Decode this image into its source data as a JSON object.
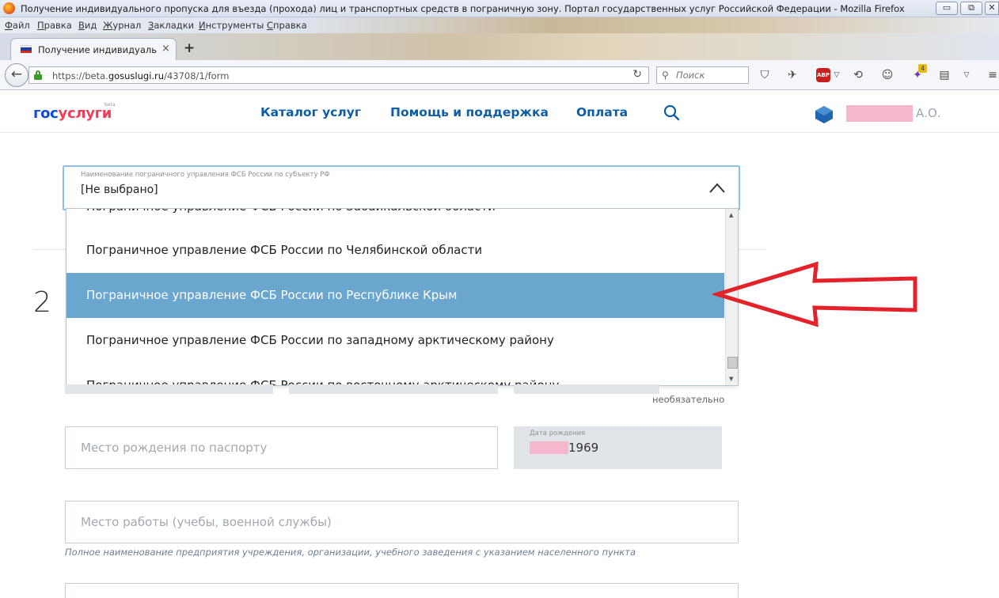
{
  "window": {
    "title": "Получение индивидуального пропуска для въезда (прохода) лиц и транспортных средств в пограничную зону. Портал государственных услуг Российской Федерации - Mozilla Firefox",
    "min_glyph": "▭",
    "max_glyph": "⧉",
    "close_glyph": "✕"
  },
  "menubar": {
    "items": [
      {
        "ul": "Ф",
        "rest": "айл"
      },
      {
        "ul": "П",
        "rest": "равка"
      },
      {
        "ul": "В",
        "rest": "ид"
      },
      {
        "ul": "Ж",
        "rest": "урнал"
      },
      {
        "ul": "З",
        "rest": "акладки"
      },
      {
        "ul": "И",
        "rest": "нструменты"
      },
      {
        "ul": "С",
        "rest": "правка"
      }
    ]
  },
  "tab": {
    "label": "Получение индивидуальн...",
    "close_glyph": "×",
    "new_tab_glyph": "+"
  },
  "navbar": {
    "back_glyph": "←",
    "url_prefix": "https://beta.",
    "url_domain": "gosuslugi.ru",
    "url_suffix": "/43708/1/form",
    "reload_glyph": "↻",
    "search_placeholder": "Поиск",
    "abp_label": "ABP",
    "ext_badge": "4"
  },
  "header": {
    "logo_part1": "гос",
    "logo_part2": "услуги",
    "logo_beta": "beta",
    "nav": [
      "Каталог услуг",
      "Помощь и поддержка",
      "Оплата"
    ],
    "user_name": "А.О."
  },
  "form": {
    "select_caption": "Наименование пограничного управления ФСБ России по субъекту РФ",
    "select_value": "[Не выбрано]",
    "step_number": "2",
    "dropdown_options": [
      "Пограничное управление ФСБ России по Забайкальской области",
      "Пограничное управление ФСБ России по Челябинской области",
      "Пограничное управление ФСБ России по Республике Крым",
      "Пограничное управление ФСБ России по западному арктическому району",
      "Пограничное управление ФСБ России по восточному арктическому району"
    ],
    "optional_hint": "необязательно",
    "birthplace_placeholder": "Место рождения по паспорту",
    "birthdate_caption": "Дата рождения",
    "birthdate_value": "1969",
    "workplace_placeholder": "Место работы (учебы, военной службы)",
    "workplace_hint": "Полное наименование предприятия учреждения, организации, учебного заведения с указанием населенного пункта"
  },
  "colors": {
    "accent_blue": "#0d5ea6",
    "selected_option": "#6aa6ce",
    "annotation_arrow": "#e3222a"
  }
}
